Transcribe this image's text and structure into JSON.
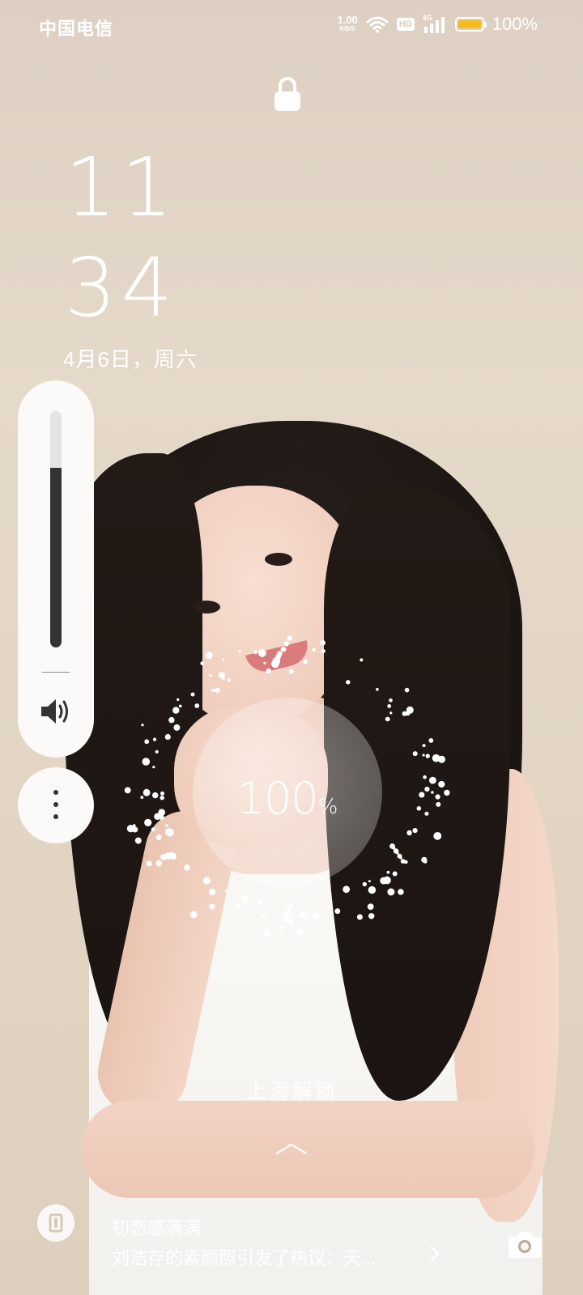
{
  "status_bar": {
    "carrier": "中国电信",
    "net_speed_value": "1.00",
    "net_speed_unit": "KB/S",
    "hd_badge": "HD",
    "signal_tag": "4G",
    "battery_percent": "100%",
    "battery_level": 1.0,
    "battery_color": "#f5bc1e",
    "icons": [
      "wifi-icon",
      "signal-icon",
      "battery-icon"
    ]
  },
  "lock": {
    "icon": "lock-icon"
  },
  "clock": {
    "hours": "11",
    "minutes": "34",
    "date": "4月6日，周六"
  },
  "volume": {
    "level": 0.76,
    "icon": "speaker-icon",
    "more_icon": "more-vertical-icon"
  },
  "charging": {
    "value": "100",
    "unit": "%"
  },
  "unlock": {
    "hint": "上滑解锁",
    "icon": "chevron-up-icon"
  },
  "notification": {
    "title": "初恋感满满",
    "body": "刘浩存的素颜照引发了热议：天...",
    "icon": "chevron-right-icon"
  },
  "shortcuts": {
    "left_icon": "app-shortcut-icon",
    "right_icon": "camera-icon"
  },
  "colors": {
    "wallpaper": "#e2d5c4",
    "panel": "#fbfaf8"
  }
}
